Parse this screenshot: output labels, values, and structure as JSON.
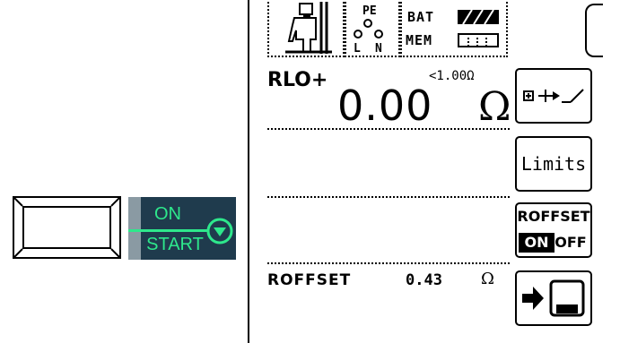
{
  "left": {
    "start_button": {
      "on_label": "ON",
      "start_label": "START"
    }
  },
  "status": {
    "pe_label": "PE",
    "l_label": "L",
    "n_label": "N",
    "bat_label": "BAT",
    "mem_label": "MEM"
  },
  "measurement": {
    "label": "RLO+",
    "limit": "<1.00Ω",
    "value": "0.00",
    "unit": "Ω"
  },
  "soft_keys": {
    "limits_label": "Limits",
    "roffset_title": "ROFFSET",
    "roffset_on": "ON",
    "roffset_off": "OFF"
  },
  "offset": {
    "label": "ROFFSET",
    "value": "0.43",
    "unit": "Ω"
  },
  "colors": {
    "button_bg": "#1f3b4d",
    "button_text": "#2ee88c"
  }
}
